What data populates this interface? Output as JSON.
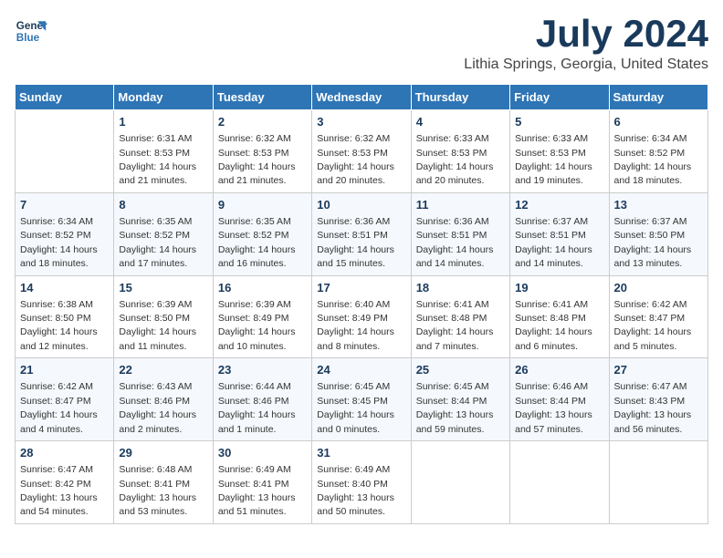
{
  "header": {
    "logo_line1": "General",
    "logo_line2": "Blue",
    "month": "July 2024",
    "location": "Lithia Springs, Georgia, United States"
  },
  "weekdays": [
    "Sunday",
    "Monday",
    "Tuesday",
    "Wednesday",
    "Thursday",
    "Friday",
    "Saturday"
  ],
  "weeks": [
    [
      {
        "day": "",
        "info": ""
      },
      {
        "day": "1",
        "info": "Sunrise: 6:31 AM\nSunset: 8:53 PM\nDaylight: 14 hours\nand 21 minutes."
      },
      {
        "day": "2",
        "info": "Sunrise: 6:32 AM\nSunset: 8:53 PM\nDaylight: 14 hours\nand 21 minutes."
      },
      {
        "day": "3",
        "info": "Sunrise: 6:32 AM\nSunset: 8:53 PM\nDaylight: 14 hours\nand 20 minutes."
      },
      {
        "day": "4",
        "info": "Sunrise: 6:33 AM\nSunset: 8:53 PM\nDaylight: 14 hours\nand 20 minutes."
      },
      {
        "day": "5",
        "info": "Sunrise: 6:33 AM\nSunset: 8:53 PM\nDaylight: 14 hours\nand 19 minutes."
      },
      {
        "day": "6",
        "info": "Sunrise: 6:34 AM\nSunset: 8:52 PM\nDaylight: 14 hours\nand 18 minutes."
      }
    ],
    [
      {
        "day": "7",
        "info": "Sunrise: 6:34 AM\nSunset: 8:52 PM\nDaylight: 14 hours\nand 18 minutes."
      },
      {
        "day": "8",
        "info": "Sunrise: 6:35 AM\nSunset: 8:52 PM\nDaylight: 14 hours\nand 17 minutes."
      },
      {
        "day": "9",
        "info": "Sunrise: 6:35 AM\nSunset: 8:52 PM\nDaylight: 14 hours\nand 16 minutes."
      },
      {
        "day": "10",
        "info": "Sunrise: 6:36 AM\nSunset: 8:51 PM\nDaylight: 14 hours\nand 15 minutes."
      },
      {
        "day": "11",
        "info": "Sunrise: 6:36 AM\nSunset: 8:51 PM\nDaylight: 14 hours\nand 14 minutes."
      },
      {
        "day": "12",
        "info": "Sunrise: 6:37 AM\nSunset: 8:51 PM\nDaylight: 14 hours\nand 14 minutes."
      },
      {
        "day": "13",
        "info": "Sunrise: 6:37 AM\nSunset: 8:50 PM\nDaylight: 14 hours\nand 13 minutes."
      }
    ],
    [
      {
        "day": "14",
        "info": "Sunrise: 6:38 AM\nSunset: 8:50 PM\nDaylight: 14 hours\nand 12 minutes."
      },
      {
        "day": "15",
        "info": "Sunrise: 6:39 AM\nSunset: 8:50 PM\nDaylight: 14 hours\nand 11 minutes."
      },
      {
        "day": "16",
        "info": "Sunrise: 6:39 AM\nSunset: 8:49 PM\nDaylight: 14 hours\nand 10 minutes."
      },
      {
        "day": "17",
        "info": "Sunrise: 6:40 AM\nSunset: 8:49 PM\nDaylight: 14 hours\nand 8 minutes."
      },
      {
        "day": "18",
        "info": "Sunrise: 6:41 AM\nSunset: 8:48 PM\nDaylight: 14 hours\nand 7 minutes."
      },
      {
        "day": "19",
        "info": "Sunrise: 6:41 AM\nSunset: 8:48 PM\nDaylight: 14 hours\nand 6 minutes."
      },
      {
        "day": "20",
        "info": "Sunrise: 6:42 AM\nSunset: 8:47 PM\nDaylight: 14 hours\nand 5 minutes."
      }
    ],
    [
      {
        "day": "21",
        "info": "Sunrise: 6:42 AM\nSunset: 8:47 PM\nDaylight: 14 hours\nand 4 minutes."
      },
      {
        "day": "22",
        "info": "Sunrise: 6:43 AM\nSunset: 8:46 PM\nDaylight: 14 hours\nand 2 minutes."
      },
      {
        "day": "23",
        "info": "Sunrise: 6:44 AM\nSunset: 8:46 PM\nDaylight: 14 hours\nand 1 minute."
      },
      {
        "day": "24",
        "info": "Sunrise: 6:45 AM\nSunset: 8:45 PM\nDaylight: 14 hours\nand 0 minutes."
      },
      {
        "day": "25",
        "info": "Sunrise: 6:45 AM\nSunset: 8:44 PM\nDaylight: 13 hours\nand 59 minutes."
      },
      {
        "day": "26",
        "info": "Sunrise: 6:46 AM\nSunset: 8:44 PM\nDaylight: 13 hours\nand 57 minutes."
      },
      {
        "day": "27",
        "info": "Sunrise: 6:47 AM\nSunset: 8:43 PM\nDaylight: 13 hours\nand 56 minutes."
      }
    ],
    [
      {
        "day": "28",
        "info": "Sunrise: 6:47 AM\nSunset: 8:42 PM\nDaylight: 13 hours\nand 54 minutes."
      },
      {
        "day": "29",
        "info": "Sunrise: 6:48 AM\nSunset: 8:41 PM\nDaylight: 13 hours\nand 53 minutes."
      },
      {
        "day": "30",
        "info": "Sunrise: 6:49 AM\nSunset: 8:41 PM\nDaylight: 13 hours\nand 51 minutes."
      },
      {
        "day": "31",
        "info": "Sunrise: 6:49 AM\nSunset: 8:40 PM\nDaylight: 13 hours\nand 50 minutes."
      },
      {
        "day": "",
        "info": ""
      },
      {
        "day": "",
        "info": ""
      },
      {
        "day": "",
        "info": ""
      }
    ]
  ]
}
